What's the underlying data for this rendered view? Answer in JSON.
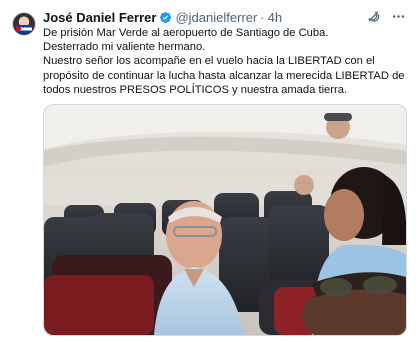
{
  "author": {
    "name": "José Daniel Ferrer",
    "handle": "@jdanielferrer",
    "time": "4h",
    "verified": true
  },
  "tweet": {
    "lines": [
      "De prisión Mar Verde al aeropuerto de Santiago de Cuba.",
      "Desterrado mi valiente hermano.",
      "Nuestro señor los acompañe en el vuelo hacia la LIBERTAD con el propósito de continuar la lucha hasta alcanzar la merecida LIBERTAD de todos nuestros PRESOS POLÍTICOS y nuestra amada tierra."
    ]
  },
  "media": {
    "description": "Photo inside airplane cabin"
  },
  "icons": {
    "grok": "grok-icon",
    "more": "more-icon",
    "verified": "verified-badge-icon"
  },
  "colors": {
    "accent": "#1d9bf0",
    "text": "#0f1419",
    "secondary": "#536471"
  }
}
